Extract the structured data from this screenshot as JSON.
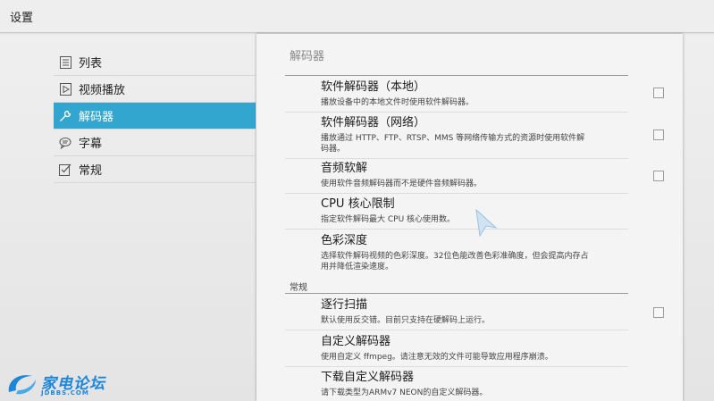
{
  "window": {
    "title": "设置"
  },
  "sidebar": {
    "items": [
      {
        "label": "列表",
        "icon": "list-icon"
      },
      {
        "label": "视频播放",
        "icon": "play-icon"
      },
      {
        "label": "解码器",
        "icon": "wrench-icon",
        "active": true
      },
      {
        "label": "字幕",
        "icon": "speech-bubble-icon"
      },
      {
        "label": "常规",
        "icon": "checklist-icon"
      }
    ]
  },
  "panel": {
    "header": "解码器",
    "rows": [
      {
        "title": "软件解码器（本地）",
        "subtitle": "播放设备中的本地文件时使用软件解码器。",
        "checked": false
      },
      {
        "title": "软件解码器（网络）",
        "subtitle": "播放通过 HTTP、FTP、RTSP、MMS 等网络传输方式的资源时使用软件解码器。",
        "checked": false
      },
      {
        "title": "音频软解",
        "subtitle": "使用软件音频解码器而不是硬件音频解码器。",
        "checked": false
      },
      {
        "title": "CPU 核心限制",
        "subtitle": "指定软件解码最大 CPU 核心使用数。"
      },
      {
        "title": "色彩深度",
        "subtitle": "选择软件解码视频的色彩深度。32位色能改善色彩准确度，但会提高内存占用并降低渲染速度。"
      }
    ],
    "section_general": "常规",
    "general_rows": [
      {
        "title": "逐行扫描",
        "subtitle": "默认使用反交错。目前只支持在硬解码上运行。",
        "checked": false
      },
      {
        "title": "自定义解码器",
        "subtitle": "使用自定义 ffmpeg。请注意无效的文件可能导致应用程序崩溃。"
      },
      {
        "title": "下载自定义解码器",
        "subtitle": "请下载类型为ARMv7 NEON的自定义解码器。"
      }
    ]
  },
  "watermark": {
    "text": "家电论坛",
    "sub": "JDBBS.COM"
  },
  "colors": {
    "accent": "#33a6cf",
    "watermark": "#1c86d8"
  }
}
